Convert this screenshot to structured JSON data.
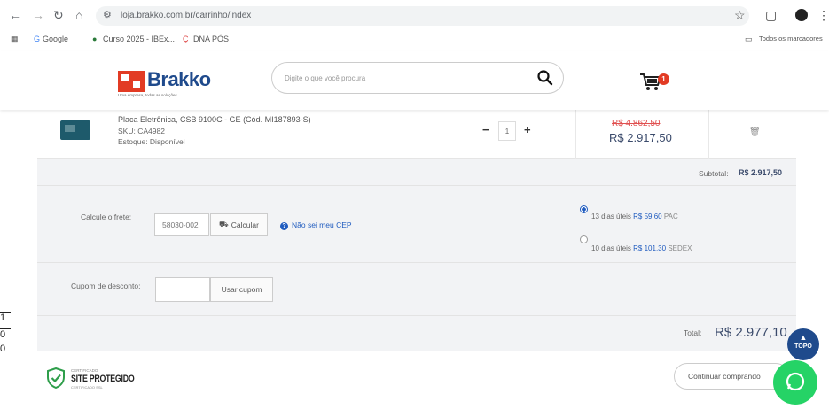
{
  "browser": {
    "url": "loja.brakko.com.br/carrinho/index",
    "bookmarks": [
      "Google",
      "Curso 2025 - IBEx...",
      "DNA PÓS"
    ],
    "all_bookmarks_label": "Todos os marcadores"
  },
  "header": {
    "logo_text": "Brakko",
    "logo_tagline": "Uma empresa, todas as soluções",
    "search_placeholder": "Digite o que você procura",
    "cart_count": "1"
  },
  "cart": {
    "item": {
      "name": "Placa Eletrônica, CSB 9100C - GE (Cód. MI187893-S)",
      "sku": "SKU: CA4982",
      "stock": "Estoque: Disponível",
      "quantity": "1",
      "price_old": "R$ 4.862,50",
      "price_new": "R$ 2.917,50"
    },
    "subtotal_label": "Subtotal:",
    "subtotal_value": "R$ 2.917,50",
    "shipping_label": "Calcule o frete:",
    "cep_value": "58030-002",
    "calc_button": "Calcular",
    "no_cep_link": "Não sei meu CEP",
    "shipping_options": [
      {
        "days": "13 dias úteis",
        "price": "R$ 59,60",
        "service": "PAC",
        "selected": true
      },
      {
        "days": "10 dias úteis",
        "price": "R$ 101,30",
        "service": "SEDEX",
        "selected": false
      }
    ],
    "coupon_label": "Cupom de desconto:",
    "coupon_button": "Usar cupom",
    "total_label": "Total:",
    "total_value": "R$ 2.977,10"
  },
  "footer": {
    "seal_top": "CERTIFICADO",
    "seal_main": "SITE PROTEGIDO",
    "seal_bottom": "CERTIFICADO SSL",
    "continue_button": "Continuar comprando",
    "top_button": "TOPO"
  },
  "left_fragment": [
    "1",
    "0",
    "0"
  ],
  "colors": {
    "brand_blue": "#1f4a8c",
    "brand_red": "#e23b24",
    "link_blue": "#1f5bbf",
    "whatsapp": "#25d366"
  }
}
